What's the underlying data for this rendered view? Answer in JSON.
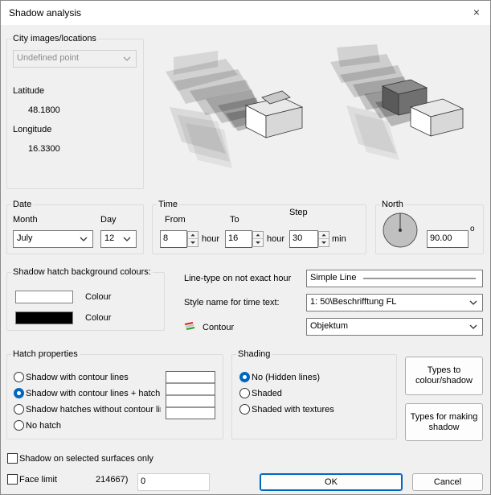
{
  "window": {
    "title": "Shadow analysis",
    "close_glyph": "×"
  },
  "city": {
    "group_label": "City images/locations",
    "location_value": "Undefined point",
    "latitude_label": "Latitude",
    "latitude_value": "48.1800",
    "longitude_label": "Longitude",
    "longitude_value": "16.3300"
  },
  "date": {
    "group_label": "Date",
    "month_label": "Month",
    "month_value": "July",
    "day_label": "Day",
    "day_value": "12"
  },
  "time": {
    "group_label": "Time",
    "from_label": "From",
    "to_label": "To",
    "step_label": "Step",
    "from_value": "8",
    "to_value": "16",
    "step_value": "30",
    "hour_unit": "hour",
    "min_unit": "min"
  },
  "north": {
    "group_label": "North",
    "value": "90.00",
    "unit": "o"
  },
  "hatch_bg": {
    "group_label": "Shadow hatch background colours:",
    "colour1_label": "Colour",
    "colour1_hex": "#ffffff",
    "colour2_label": "Colour",
    "colour2_hex": "#000000"
  },
  "linetype": {
    "label": "Line-type on not exact hour",
    "value": "Simple Line",
    "style_label": "Style name for time text:",
    "style_value": "1: 50\\Beschrifftung FL",
    "contour_label": "Contour",
    "contour_value": "Objektum"
  },
  "hatch_props": {
    "group_label": "Hatch properties",
    "options": [
      {
        "label": "Shadow with contour lines",
        "checked": false
      },
      {
        "label": "Shadow with contour lines + hatch",
        "checked": true
      },
      {
        "label": "Shadow hatches without contour lines",
        "checked": false
      },
      {
        "label": "No hatch",
        "checked": false
      }
    ]
  },
  "shading": {
    "group_label": "Shading",
    "options": [
      {
        "label": "No (Hidden lines)",
        "checked": true
      },
      {
        "label": "Shaded",
        "checked": false
      },
      {
        "label": "Shaded with textures",
        "checked": false
      }
    ]
  },
  "buttons": {
    "types_colour_line1": "Types to",
    "types_colour_line2": "colour/shadow",
    "types_making_line1": "Types for making",
    "types_making_line2": "shadow",
    "ok": "OK",
    "cancel": "Cancel"
  },
  "footer": {
    "selected_surfaces_label": "Shadow on selected surfaces only",
    "face_limit_label": "Face limit",
    "face_limit_code": "214667)",
    "face_limit_value": "0"
  },
  "colors": {
    "accent": "#0067c0",
    "group_border": "#dcdcdc",
    "background": "#f0f0f0"
  }
}
